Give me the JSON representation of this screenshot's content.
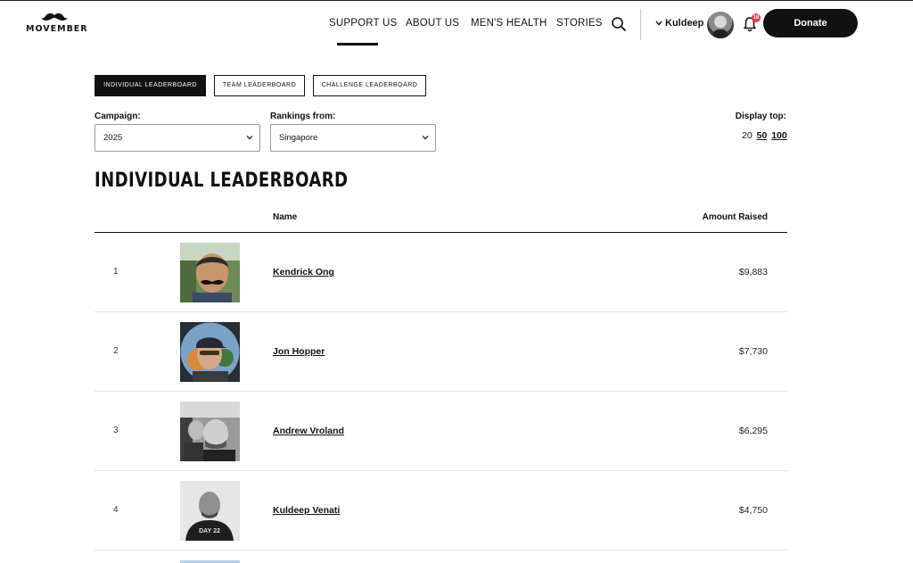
{
  "header": {
    "logo_text": "MOVEMBER",
    "nav": [
      {
        "label": "SUPPORT US"
      },
      {
        "label": "ABOUT US"
      },
      {
        "label": "MEN'S HEALTH"
      },
      {
        "label": "STORIES"
      }
    ],
    "active_nav": "SUPPORT US",
    "user_name": "Kuldeep",
    "notification_count": "18",
    "donate_label": "Donate"
  },
  "tabs": [
    {
      "label": "INDIVIDUAL LEADERBOARD",
      "active": true
    },
    {
      "label": "TEAM LEADERBOARD",
      "active": false
    },
    {
      "label": "CHALLENGE LEADERBOARD",
      "active": false
    }
  ],
  "filters": {
    "campaign_label": "Campaign:",
    "campaign_value": "2025",
    "rankings_label": "Rankings from:",
    "rankings_value": "Singapore",
    "display_top_label": "Display top:",
    "display_top_options": [
      "20",
      "50",
      "100"
    ]
  },
  "title": "INDIVIDUAL LEADERBOARD",
  "table": {
    "columns": {
      "name": "Name",
      "amount": "Amount Raised"
    },
    "rows": [
      {
        "rank": "1",
        "name": "Kendrick Ong",
        "amount": "$9,883"
      },
      {
        "rank": "2",
        "name": "Jon Hopper",
        "amount": "$7,730"
      },
      {
        "rank": "3",
        "name": "Andrew Vroland",
        "amount": "$6,295"
      },
      {
        "rank": "4",
        "name": "Kuldeep Venati",
        "amount": "$4,750"
      }
    ]
  },
  "photo_captions": {
    "row4_shirt": "DAY 22"
  },
  "colors": {
    "brand": "#111111",
    "badge": "#e53935"
  }
}
